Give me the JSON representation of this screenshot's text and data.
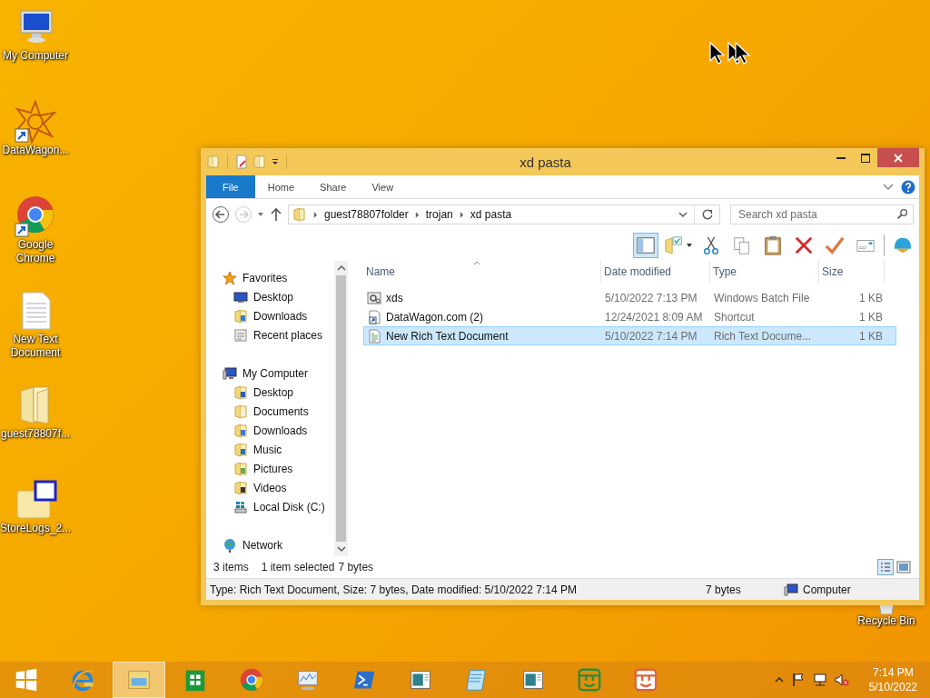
{
  "desktop_icons": [
    {
      "label": "My Computer",
      "kind": "computer",
      "shortcut": false
    },
    {
      "label": "DataWagon...",
      "kind": "star",
      "shortcut": true
    },
    {
      "label": "Google Chrome",
      "kind": "chrome",
      "shortcut": true
    },
    {
      "label": "New Text Document",
      "kind": "text",
      "shortcut": false
    },
    {
      "label": "guest78807f...",
      "kind": "folder",
      "shortcut": false
    },
    {
      "label": "StoreLogs_2...",
      "kind": "ca",
      "shortcut": false
    }
  ],
  "recycle_bin": {
    "label": "Recycle Bin"
  },
  "window": {
    "title": "xd pasta",
    "ribbon_tabs": [
      {
        "label": "File",
        "kind": "file",
        "selected": false
      },
      {
        "label": "Home",
        "kind": "tab",
        "selected": false
      },
      {
        "label": "Share",
        "kind": "tab",
        "selected": false
      },
      {
        "label": "View",
        "kind": "tab",
        "selected": false
      }
    ],
    "address": [
      "guest78807folder",
      "trojan",
      "xd pasta"
    ],
    "search": {
      "placeholder": "Search xd pasta"
    },
    "toolbar": [
      {
        "kind": "pane",
        "active": true
      },
      {
        "kind": "folder-check",
        "active": false
      },
      {
        "kind": "cut",
        "active": false
      },
      {
        "kind": "copy",
        "active": false
      },
      {
        "kind": "paste",
        "active": false
      },
      {
        "kind": "delete",
        "active": false
      },
      {
        "kind": "check",
        "active": false
      },
      {
        "kind": "card",
        "active": false
      },
      {
        "kind": "shell",
        "active": false
      }
    ],
    "nav": [
      {
        "label": "Favorites",
        "kind": "star",
        "children": [
          {
            "label": "Desktop",
            "kind": "desktop"
          },
          {
            "label": "Downloads",
            "kind": "downloads"
          },
          {
            "label": "Recent places",
            "kind": "recent"
          }
        ]
      },
      {
        "label": "My Computer",
        "kind": "computer",
        "children": [
          {
            "label": "Desktop",
            "kind": "desktop-folder"
          },
          {
            "label": "Documents",
            "kind": "documents"
          },
          {
            "label": "Downloads",
            "kind": "downloads"
          },
          {
            "label": "Music",
            "kind": "music"
          },
          {
            "label": "Pictures",
            "kind": "pictures"
          },
          {
            "label": "Videos",
            "kind": "videos"
          },
          {
            "label": "Local Disk (C:)",
            "kind": "disk"
          }
        ]
      },
      {
        "label": "Network",
        "kind": "network"
      }
    ],
    "columns": [
      "Name",
      "Date modified",
      "Type",
      "Size"
    ],
    "rows": [
      {
        "name": "xds",
        "kind": "batch",
        "date": "5/10/2022 7:13 PM",
        "type": "Windows Batch File",
        "size": "1 KB",
        "selected": false
      },
      {
        "name": "DataWagon.com (2)",
        "kind": "shortcut",
        "date": "12/24/2021 8:09 AM",
        "type": "Shortcut",
        "size": "1 KB",
        "selected": false
      },
      {
        "name": "New Rich Text Document",
        "kind": "rtf",
        "date": "5/10/2022 7:14 PM",
        "type": "Rich Text Docume...",
        "size": "1 KB",
        "selected": true
      }
    ],
    "status": {
      "items": "3 items",
      "selected": "1 item selected",
      "bytes": "7 bytes"
    },
    "details": {
      "text": "Type: Rich Text Document, Size: 7 bytes, Date modified: 5/10/2022 7:14 PM",
      "size": "7 bytes",
      "zone": "Computer"
    }
  },
  "taskbar": {
    "apps": [
      {
        "kind": "start",
        "active": false
      },
      {
        "kind": "ie",
        "active": false
      },
      {
        "kind": "explorer",
        "active": true
      },
      {
        "kind": "store",
        "active": false
      },
      {
        "kind": "chrome",
        "active": false
      },
      {
        "kind": "monitor",
        "active": false
      },
      {
        "kind": "powershell",
        "active": false
      },
      {
        "kind": "doc",
        "active": false
      },
      {
        "kind": "notepad",
        "active": false
      },
      {
        "kind": "doc",
        "active": false
      },
      {
        "kind": "green",
        "active": false
      },
      {
        "kind": "red",
        "active": false
      }
    ],
    "time": "7:14 PM",
    "date": "5/10/2022"
  }
}
